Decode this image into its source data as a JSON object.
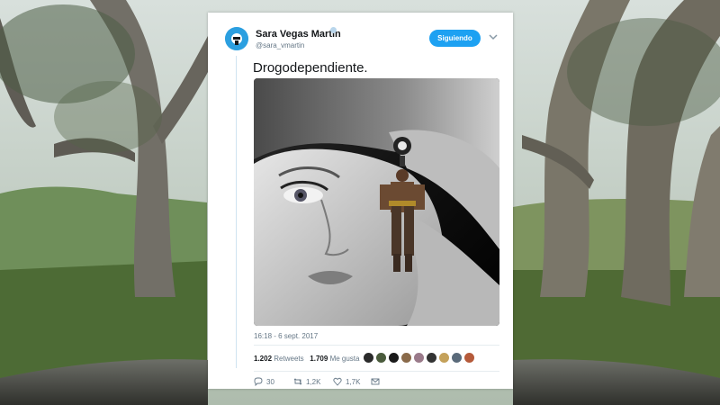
{
  "tweet": {
    "author_name": "Sara Vegas Martín",
    "author_handle": "@sara_vmartin",
    "follow_label": "Siguiendo",
    "text": "Drogodependiente.",
    "timestamp": "16:18 - 6 sept. 2017",
    "retweets_count": "1.202",
    "retweets_label": "Retweets",
    "likes_count": "1.709",
    "likes_label": "Me gusta",
    "replies": "30",
    "retweets_short": "1,2K",
    "likes_short": "1,7K"
  },
  "icons": {
    "avatar": "avatar-icon",
    "verified": "verified-icon",
    "menu": "chevron-down-icon",
    "reply": "reply-icon",
    "retweet": "retweet-icon",
    "like": "heart-icon",
    "message": "envelope-icon"
  },
  "colors": {
    "accent": "#1da1f2",
    "text": "#14171a",
    "secondary": "#657786"
  },
  "likers_count_visible": 9
}
